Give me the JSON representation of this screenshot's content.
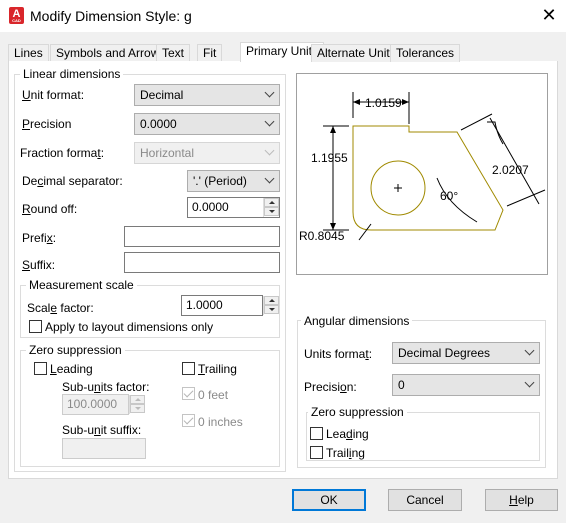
{
  "window": {
    "title": "Modify Dimension Style: g",
    "app_icon_letter": "A",
    "app_icon_sub": "CAD",
    "close_glyph": "✕"
  },
  "tabs": [
    {
      "label": "Lines"
    },
    {
      "label": "Symbols and Arrows"
    },
    {
      "label": "Text"
    },
    {
      "label": "Fit"
    },
    {
      "label": "Primary Units"
    },
    {
      "label": "Alternate Units"
    },
    {
      "label": "Tolerances"
    }
  ],
  "active_tab": "Primary Units",
  "linear": {
    "group_label": "Linear dimensions",
    "unit_format": {
      "label_u": "U",
      "label_rest": "nit format:",
      "value": "Decimal"
    },
    "precision": {
      "label_u": "P",
      "label_rest": "recision",
      "value": "0.0000"
    },
    "fraction_format": {
      "label_pre": "Fraction forma",
      "label_u": "t",
      "label_rest": ":",
      "value": "Horizontal"
    },
    "decimal_separator": {
      "label_pre": "De",
      "label_u": "c",
      "label_rest": "imal separator:",
      "value": "'.' (Period)"
    },
    "round_off": {
      "label_u": "R",
      "label_rest": "ound off:",
      "value": "0.0000"
    },
    "prefix": {
      "label_pre": "Prefi",
      "label_u": "x",
      "label_rest": ":",
      "value": ""
    },
    "suffix": {
      "label_u": "S",
      "label_rest": "uffix:",
      "value": ""
    }
  },
  "measurement_scale": {
    "group_label": "Measurement scale",
    "scale_factor": {
      "label_pre": "Scal",
      "label_u": "e",
      "label_rest": " factor:",
      "value": "1.0000"
    },
    "apply_layout": {
      "label": "Apply to layout dimensions only",
      "checked": false
    }
  },
  "zero_suppression_linear": {
    "group_label": "Zero suppression",
    "leading": {
      "label_u": "L",
      "label_rest": "eading",
      "checked": false
    },
    "trailing": {
      "label_u": "T",
      "label_rest": "railing",
      "checked": false
    },
    "sub_units_factor": {
      "label_pre": "Sub-u",
      "label_u": "n",
      "label_rest": "its factor:",
      "value": "100.0000"
    },
    "sub_unit_suffix": {
      "label_pre": "Sub-u",
      "label_u": "n",
      "label_rest": "it suffix:",
      "value": ""
    },
    "zero_feet": {
      "label": "0 feet",
      "checked": true
    },
    "zero_inches": {
      "label": "0 inches",
      "checked": true
    }
  },
  "preview": {
    "dim_top": "1.0159",
    "dim_left": "1.1955",
    "dim_right": "2.0207",
    "angle": "60°",
    "radius": "R0.8045",
    "line_color": "#a08a00"
  },
  "angular": {
    "group_label": "Angular dimensions",
    "units_format": {
      "label_pre": "Units forma",
      "label_u": "t",
      "label_rest": ":",
      "value": "Decimal Degrees"
    },
    "precision": {
      "label_pre": "Precisi",
      "label_u": "o",
      "label_rest": "n:",
      "value": "0"
    },
    "zero_suppression": {
      "group_label": "Zero suppression",
      "leading": {
        "label_pre": "Lea",
        "label_u": "d",
        "label_rest": "ing",
        "checked": false
      },
      "trailing": {
        "label_pre": "Trail",
        "label_u": "i",
        "label_rest": "ng",
        "checked": false
      }
    }
  },
  "buttons": {
    "ok": "OK",
    "cancel": "Cancel",
    "help_u": "H",
    "help_rest": "elp"
  },
  "colors": {
    "accent": "#0078d7",
    "app_icon": "#d9262b"
  }
}
